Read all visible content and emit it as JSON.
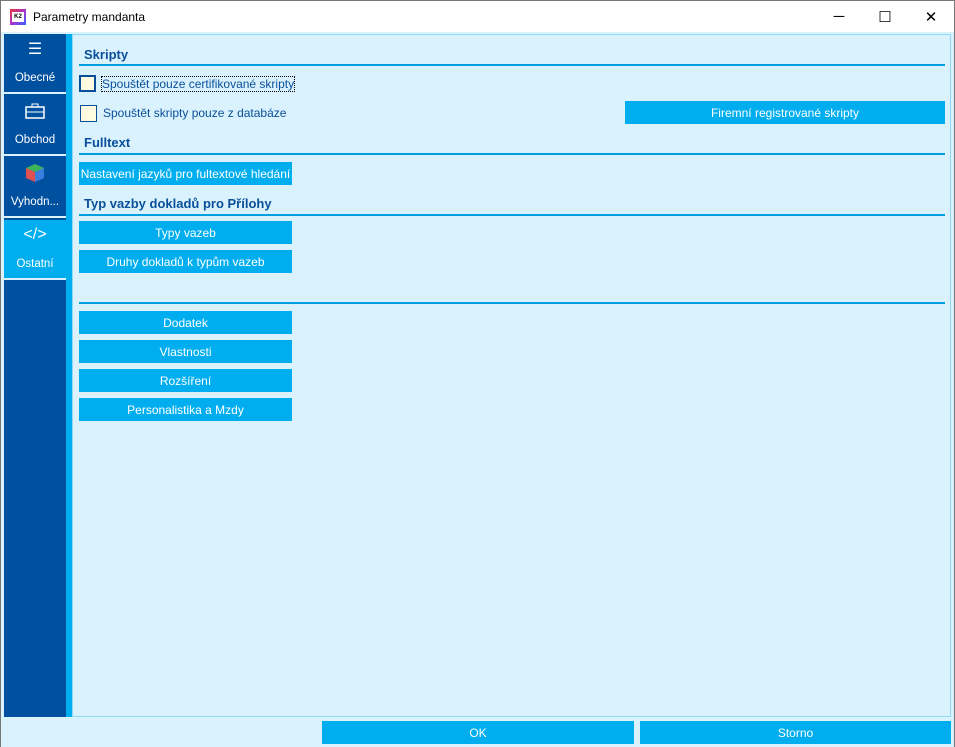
{
  "window": {
    "title": "Parametry mandanta",
    "icon_text": "K2",
    "minimize": "─",
    "maximize": "☐",
    "close": "✕"
  },
  "sidebar": {
    "items": [
      {
        "label": "Obecné",
        "icon": "list-icon"
      },
      {
        "label": "Obchod",
        "icon": "briefcase-icon"
      },
      {
        "label": "Vyhodn...",
        "icon": "cube-icon"
      },
      {
        "label": "Ostatní",
        "icon": "code-icon",
        "active": true
      }
    ]
  },
  "sections": {
    "scripts": {
      "title": "Skripty",
      "certified_label": "Spouštět pouze certifikované skripty",
      "certified_checked": false,
      "db_label": "Spouštět skripty pouze z databáze",
      "db_checked": false,
      "registered_button": "Firemní registrované skripty"
    },
    "fulltext": {
      "title": "Fulltext",
      "languages_button": "Nastavení jazyků pro fultextové hledání"
    },
    "attachments": {
      "title": "Typ vazby dokladů pro Přílohy",
      "types_button": "Typy vazeb",
      "doc_types_button": "Druhy dokladů k typům vazeb"
    },
    "other": {
      "buttons": [
        "Dodatek",
        "Vlastnosti",
        "Rozšíření",
        "Personalistika a Mzdy"
      ]
    }
  },
  "footer": {
    "ok": "OK",
    "cancel": "Storno"
  }
}
